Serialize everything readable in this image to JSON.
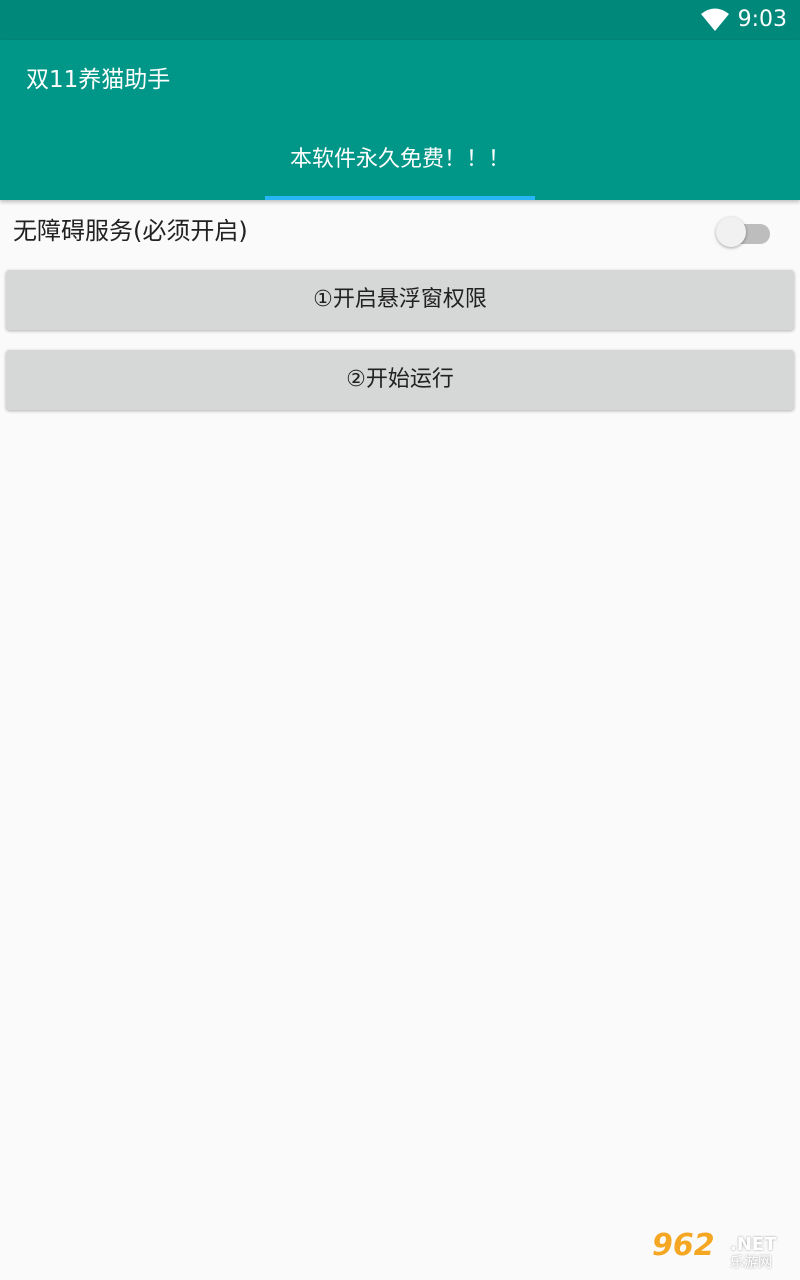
{
  "status_bar": {
    "time": "9:03",
    "wifi_icon": "wifi-icon"
  },
  "app_bar": {
    "title": "双11养猫助手",
    "tabs": [
      {
        "label": "本软件永久免费！！！",
        "selected": true
      }
    ]
  },
  "accessibility": {
    "label": "无障碍服务(必须开启)",
    "enabled": false
  },
  "buttons": {
    "overlay_permission": "①开启悬浮窗权限",
    "start": "②开始运行"
  },
  "watermark": {
    "logo": "962",
    "suffix": ".NET",
    "site": "乐游网"
  },
  "colors": {
    "status_bar": "#00897b",
    "app_bar": "#009688",
    "tab_indicator": "#29b6f6",
    "button": "#d6d7d7",
    "background": "#fafafa"
  }
}
